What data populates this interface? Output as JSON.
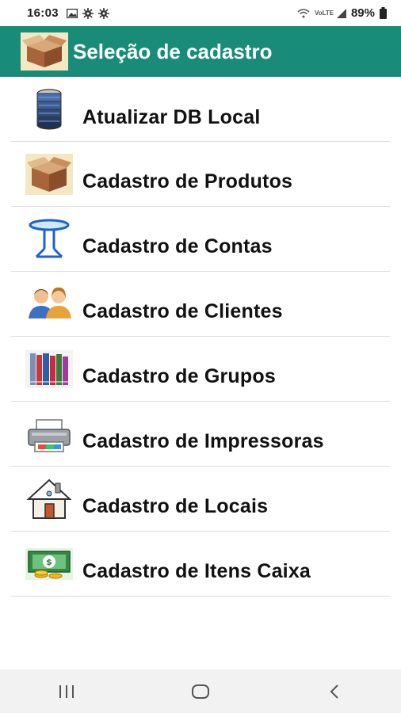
{
  "status_bar": {
    "time": "16:03",
    "battery": "89%",
    "network": "VoLTE"
  },
  "app_bar": {
    "title": "Seleção de cadastro",
    "background": "#198c79",
    "logo_icon": "package-box-icon"
  },
  "menu": {
    "items": [
      {
        "label": "Atualizar DB Local",
        "icon": "database-icon"
      },
      {
        "label": "Cadastro de Produtos",
        "icon": "package-box-icon"
      },
      {
        "label": "Cadastro de Contas",
        "icon": "table-icon"
      },
      {
        "label": "Cadastro de Clientes",
        "icon": "users-icon"
      },
      {
        "label": "Cadastro de Grupos",
        "icon": "books-icon"
      },
      {
        "label": "Cadastro de Impressoras",
        "icon": "printer-icon"
      },
      {
        "label": "Cadastro de Locais",
        "icon": "house-icon"
      },
      {
        "label": "Cadastro de Itens Caixa",
        "icon": "money-icon"
      }
    ]
  },
  "nav_bar": {
    "recents_icon": "recents-icon",
    "home_icon": "home-icon",
    "back_icon": "back-icon"
  }
}
